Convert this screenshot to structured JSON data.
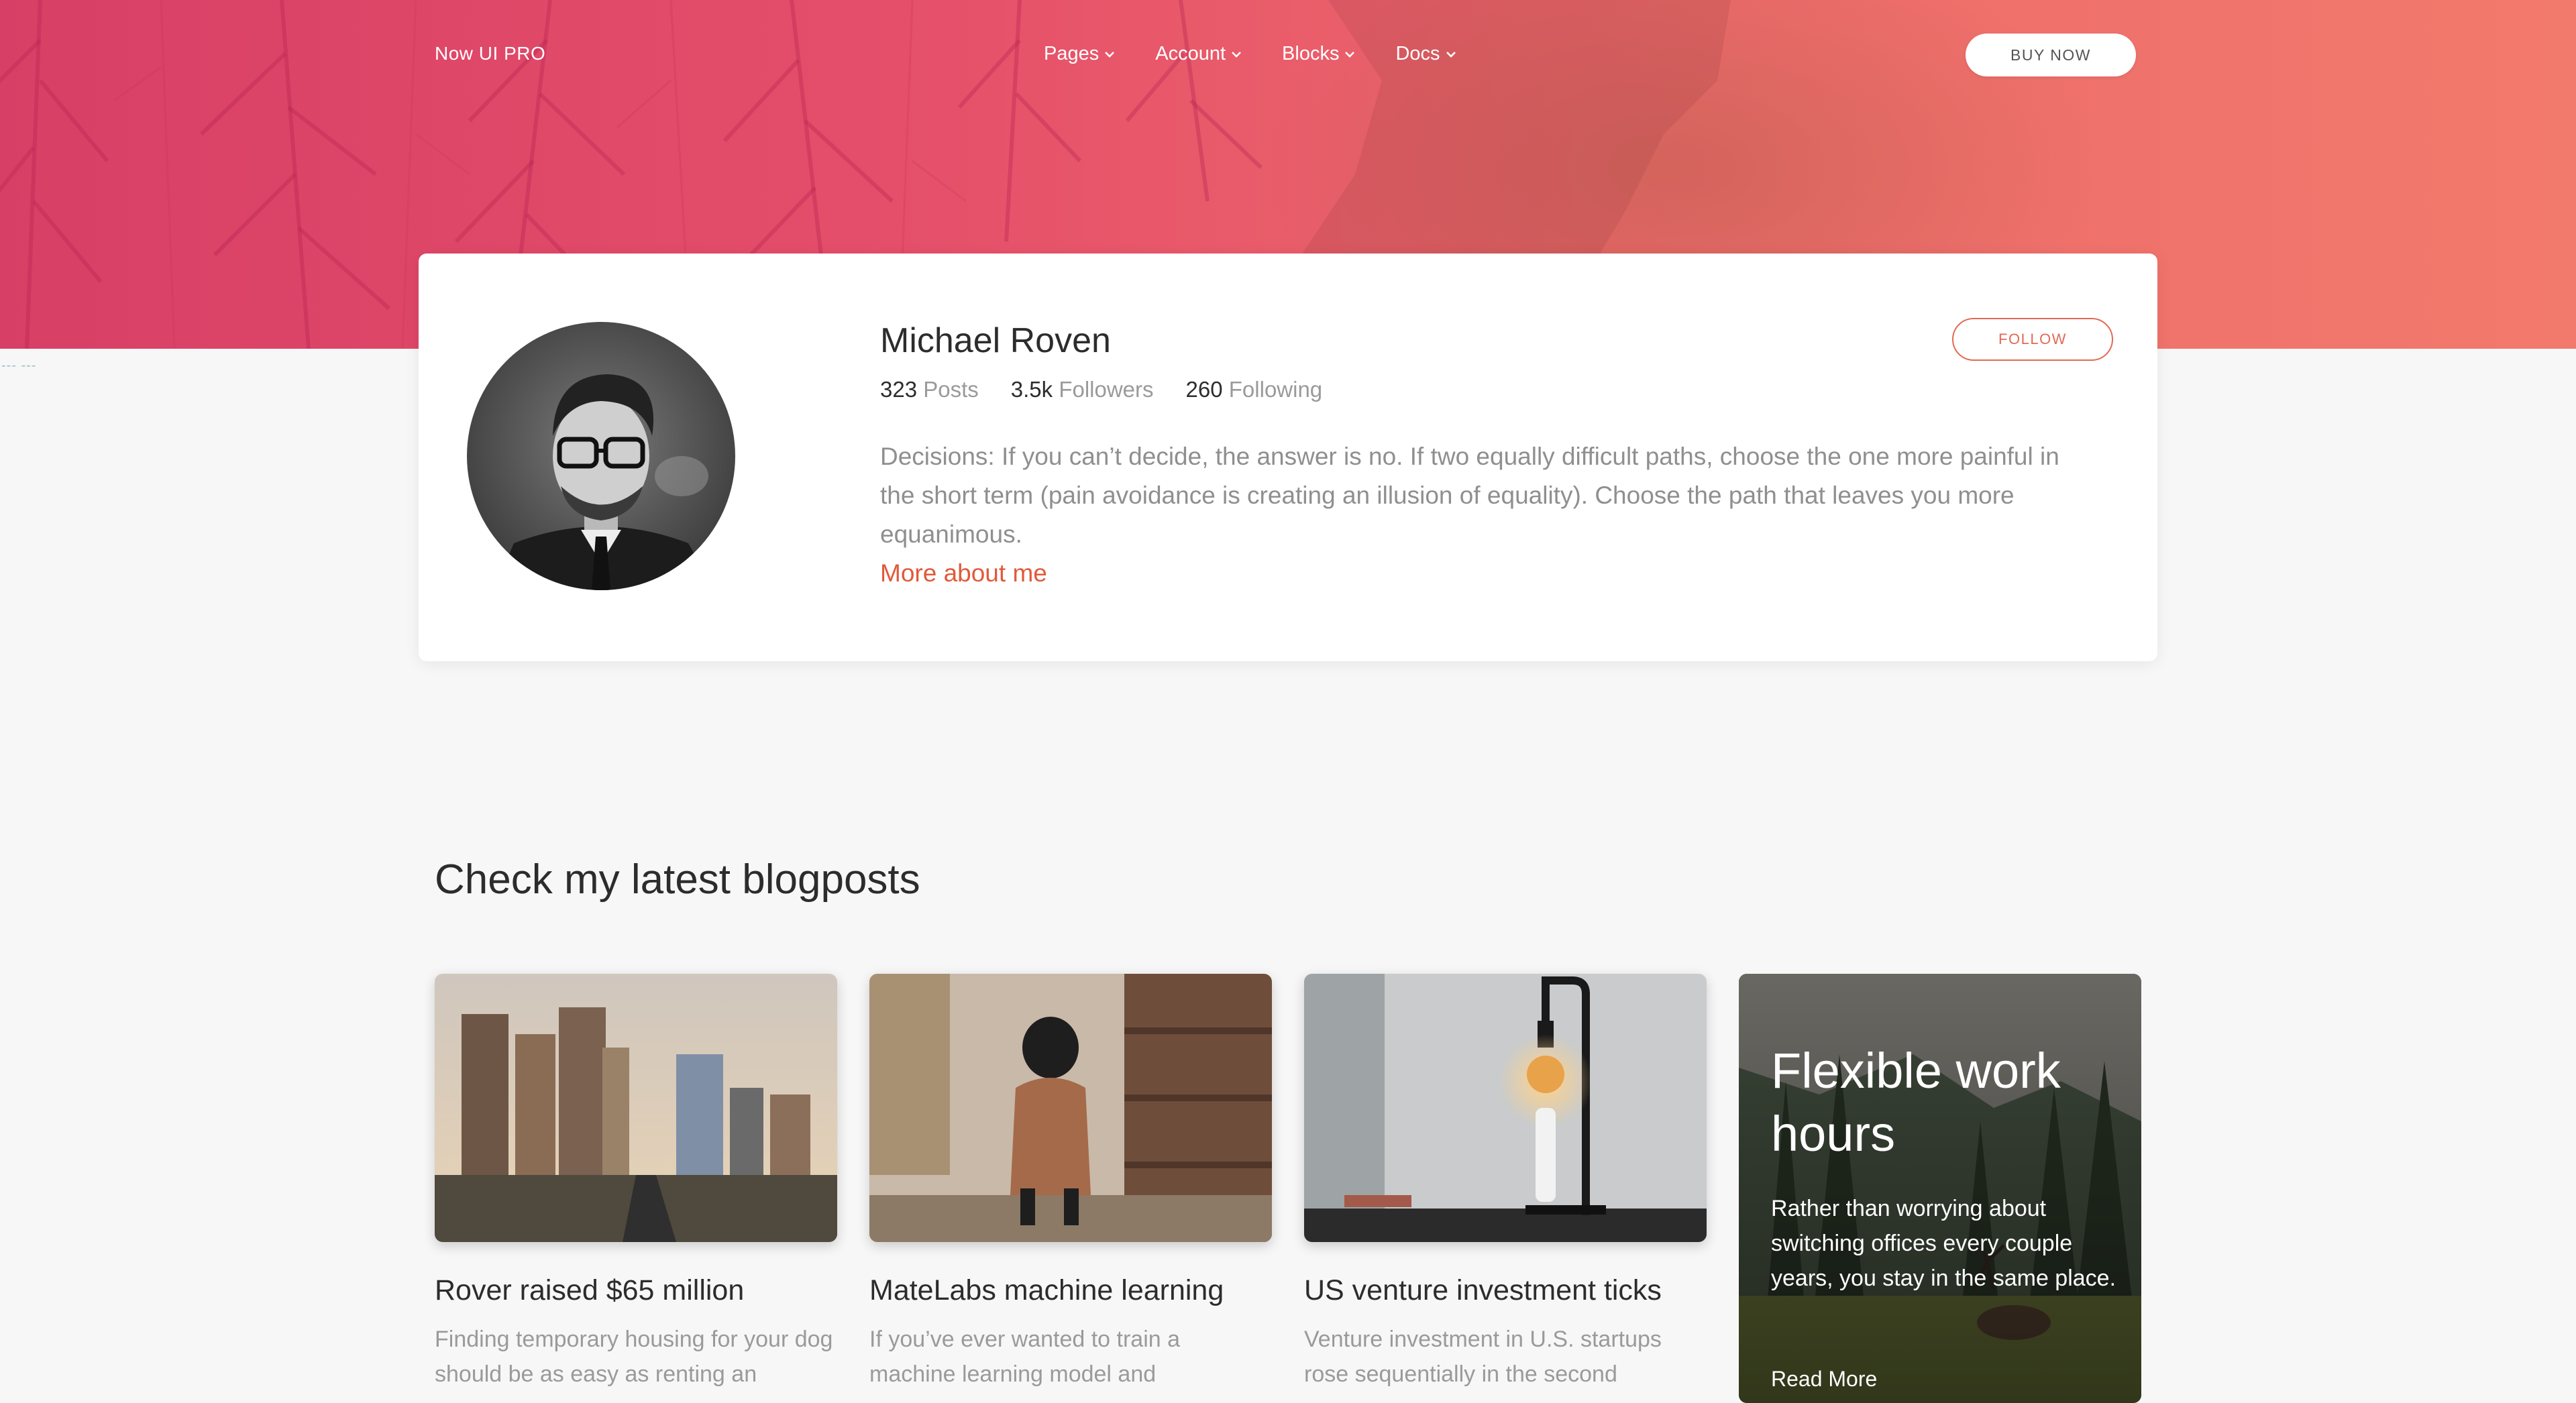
{
  "navbar": {
    "brand": "Now UI PRO",
    "items": [
      {
        "label": "Pages"
      },
      {
        "label": "Account"
      },
      {
        "label": "Blocks"
      },
      {
        "label": "Docs"
      }
    ],
    "cta_label": "BUY NOW"
  },
  "marker_text": "--- ---",
  "profile": {
    "name": "Michael Roven",
    "stats": [
      {
        "value": "323",
        "label": "Posts"
      },
      {
        "value": "3.5k",
        "label": "Followers"
      },
      {
        "value": "260",
        "label": "Following"
      }
    ],
    "bio": "Decisions: If you can’t decide, the answer is no. If two equally difficult paths, choose the one more painful in the short term (pain avoidance is creating an illusion of equality). Choose the path that leaves you more equanimous.",
    "more_link": "More about me",
    "follow_label": "FOLLOW"
  },
  "blog": {
    "heading": "Check my latest blogposts",
    "posts": [
      {
        "title": "Rover raised $65 million",
        "excerpt": "Finding temporary housing for your dog should be as easy as renting an"
      },
      {
        "title": "MateLabs machine learning",
        "excerpt": "If you’ve ever wanted to train a machine learning model and"
      },
      {
        "title": "US venture investment ticks",
        "excerpt": "Venture investment in U.S. startups rose sequentially in the second"
      }
    ],
    "feature": {
      "title": "Flexible work hours",
      "text": "Rather than worrying about switching offices every couple years, you stay in the same place.",
      "link": "Read More"
    }
  },
  "colors": {
    "hero_start": "#d83f66",
    "hero_end": "#f27a6c",
    "accent": "#e05a3a"
  },
  "icons": {
    "nav_caret": "chevron-down-icon"
  }
}
